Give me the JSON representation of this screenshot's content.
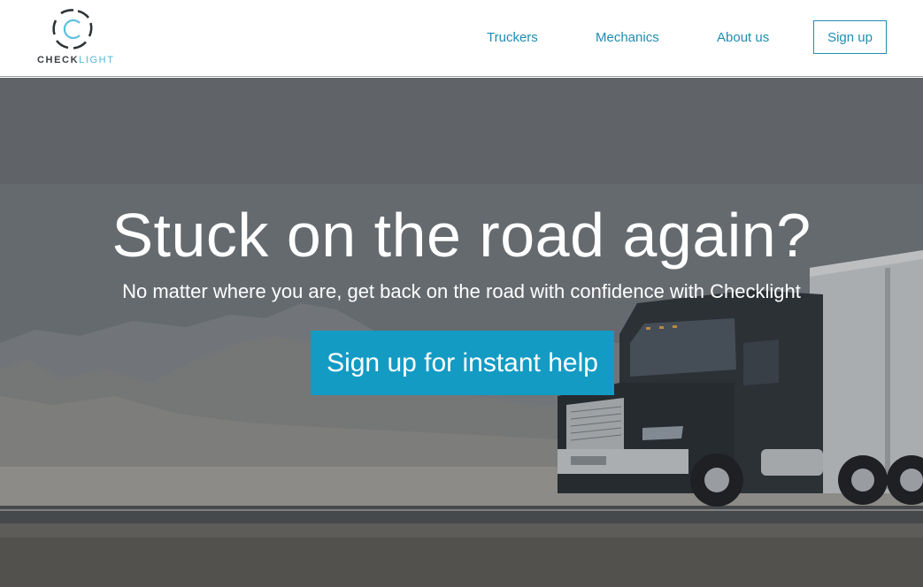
{
  "brand": {
    "logo_part1": "CHECK",
    "logo_part2": "LIGHT",
    "accent_color": "#1e8db3",
    "logo_icon": "camera-aperture-icon"
  },
  "nav": {
    "items": [
      {
        "label": "Truckers"
      },
      {
        "label": "Mechanics"
      },
      {
        "label": "About us"
      }
    ],
    "signup_label": "Sign up"
  },
  "hero": {
    "title": "Stuck on the road again?",
    "subtitle": "No matter where you are, get back on the road with confidence with Checklight",
    "cta_label": "Sign up for instant help",
    "cta_color": "#139bc4",
    "background_image": "semi-truck-on-desert-highway"
  }
}
